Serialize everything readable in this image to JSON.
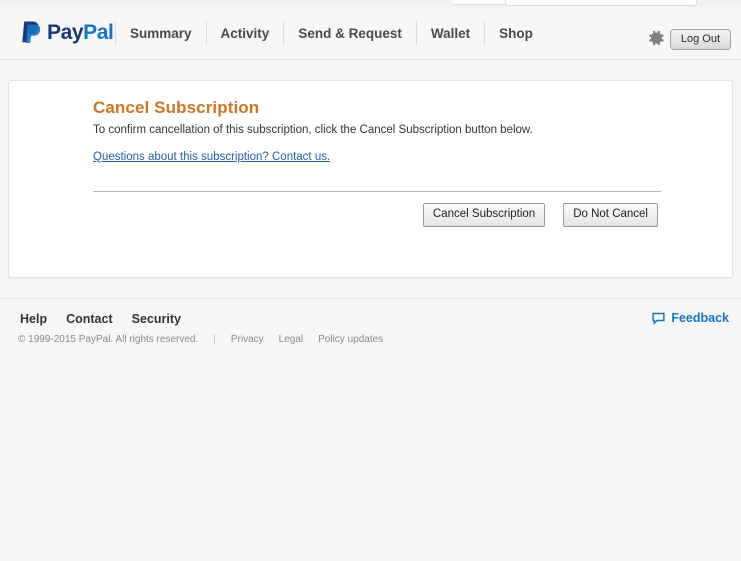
{
  "brand": {
    "logo_pay": "Pay",
    "logo_pal": "Pal",
    "accent_orange": "#cc7722",
    "link_blue": "#2360a5",
    "brand_blue": "#1775c4",
    "logo_navy": "#1b3a75"
  },
  "header": {
    "nav": [
      {
        "label": "Summary"
      },
      {
        "label": "Activity"
      },
      {
        "label": "Send & Request"
      },
      {
        "label": "Wallet"
      },
      {
        "label": "Shop"
      }
    ],
    "settings_icon": "gear-icon",
    "logout_label": "Log Out"
  },
  "main": {
    "title": "Cancel Subscription",
    "body": "To confirm cancellation of this subscription, click the Cancel Subscription button below.",
    "contact_link": "Questions about this subscription? Contact us.",
    "primary_button": "Cancel Subscription",
    "secondary_button": "Do Not Cancel"
  },
  "footer": {
    "links": [
      {
        "label": "Help"
      },
      {
        "label": "Contact"
      },
      {
        "label": "Security"
      }
    ],
    "copyright": "© 1999-2015 PayPal. All rights reserved.",
    "separator": "|",
    "legal_links": [
      {
        "label": "Privacy"
      },
      {
        "label": "Legal"
      },
      {
        "label": "Policy updates"
      }
    ],
    "feedback_label": "Feedback",
    "feedback_icon": "speech-bubble-icon"
  }
}
